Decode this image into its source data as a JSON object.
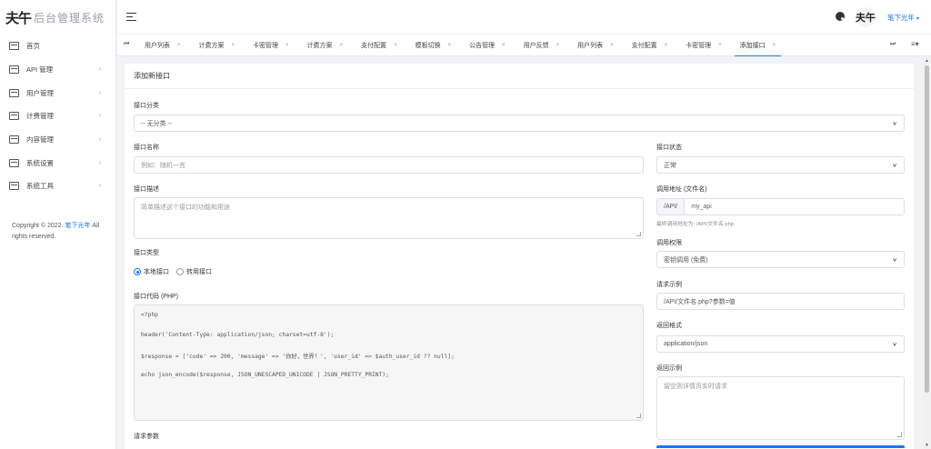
{
  "app": {
    "logo_mark": "夫午",
    "logo_text": "后台管理系统"
  },
  "sidebar": {
    "items": [
      {
        "label": "首页",
        "icon": "home-icon",
        "has_arrow": false
      },
      {
        "label": "API 管理",
        "icon": "calendar-icon",
        "has_arrow": true
      },
      {
        "label": "用户管理",
        "icon": "calendar-icon",
        "has_arrow": true
      },
      {
        "label": "计费管理",
        "icon": "calendar-icon",
        "has_arrow": true
      },
      {
        "label": "内容管理",
        "icon": "calendar-icon",
        "has_arrow": true
      },
      {
        "label": "系统设置",
        "icon": "calendar-icon",
        "has_arrow": true
      },
      {
        "label": "系统工具",
        "icon": "calendar-icon",
        "has_arrow": true
      }
    ],
    "arrow": "›",
    "copyright_prefix": "Copyright © 2022. ",
    "copyright_link": "笔下光年",
    "copyright_suffix": " All rights reserved."
  },
  "header": {
    "avatar_text": "夫午",
    "username": "笔下光年",
    "caret": "▾"
  },
  "tabs": {
    "prev": "⏮",
    "next": "⏭",
    "menu": "≡▾",
    "close": "×",
    "items": [
      {
        "label": "用户列表",
        "active": false
      },
      {
        "label": "计费方案",
        "active": false
      },
      {
        "label": "卡密管理",
        "active": false
      },
      {
        "label": "计费方案",
        "active": false
      },
      {
        "label": "支付配置",
        "active": false
      },
      {
        "label": "模板切换",
        "active": false
      },
      {
        "label": "公告管理",
        "active": false
      },
      {
        "label": "用户反馈",
        "active": false
      },
      {
        "label": "用户列表",
        "active": false
      },
      {
        "label": "支付配置",
        "active": false
      },
      {
        "label": "卡密管理",
        "active": false
      },
      {
        "label": "添加接口",
        "active": true
      }
    ]
  },
  "form": {
    "title": "添加新接口",
    "category": {
      "label": "接口分类",
      "value": "-- 无分类 --"
    },
    "name": {
      "label": "接口名称",
      "placeholder": "例如：随机一言"
    },
    "status": {
      "label": "接口状态",
      "value": "正常"
    },
    "description": {
      "label": "接口描述",
      "placeholder": "简单描述这个接口的功能和用途"
    },
    "call_url": {
      "label": "调用地址 (文件名)",
      "prefix": "/API/",
      "value": "my_api",
      "hint": "最终调用地址为: /API/文件名.php"
    },
    "permission": {
      "label": "调用权限",
      "value": "密钥调用 (免费)"
    },
    "type": {
      "label": "接口类型",
      "options": [
        "本地接口",
        "转用接口"
      ],
      "selected": 0
    },
    "request_example": {
      "label": "请求示例",
      "value": "/API/文件名.php?参数=值"
    },
    "code": {
      "label": "接口代码 (PHP)",
      "lines": [
        "<?php",
        "",
        "header('Content-Type: application/json; charset=utf-8');",
        "",
        "$response = ['code' => 200, 'message' => '你好，世界！', 'user_id' => $auth_user_id ?? null];",
        "",
        "echo json_encode($response, JSON_UNESCAPED_UNICODE | JSON_PRETTY_PRINT);"
      ]
    },
    "return_format": {
      "label": "返回格式",
      "value": "application/json"
    },
    "return_example": {
      "label": "返回示例",
      "placeholder": "留空则详情页实时请求"
    },
    "request_params": {
      "label": "请求参数"
    }
  },
  "colors": {
    "accent": "#1677ff"
  }
}
